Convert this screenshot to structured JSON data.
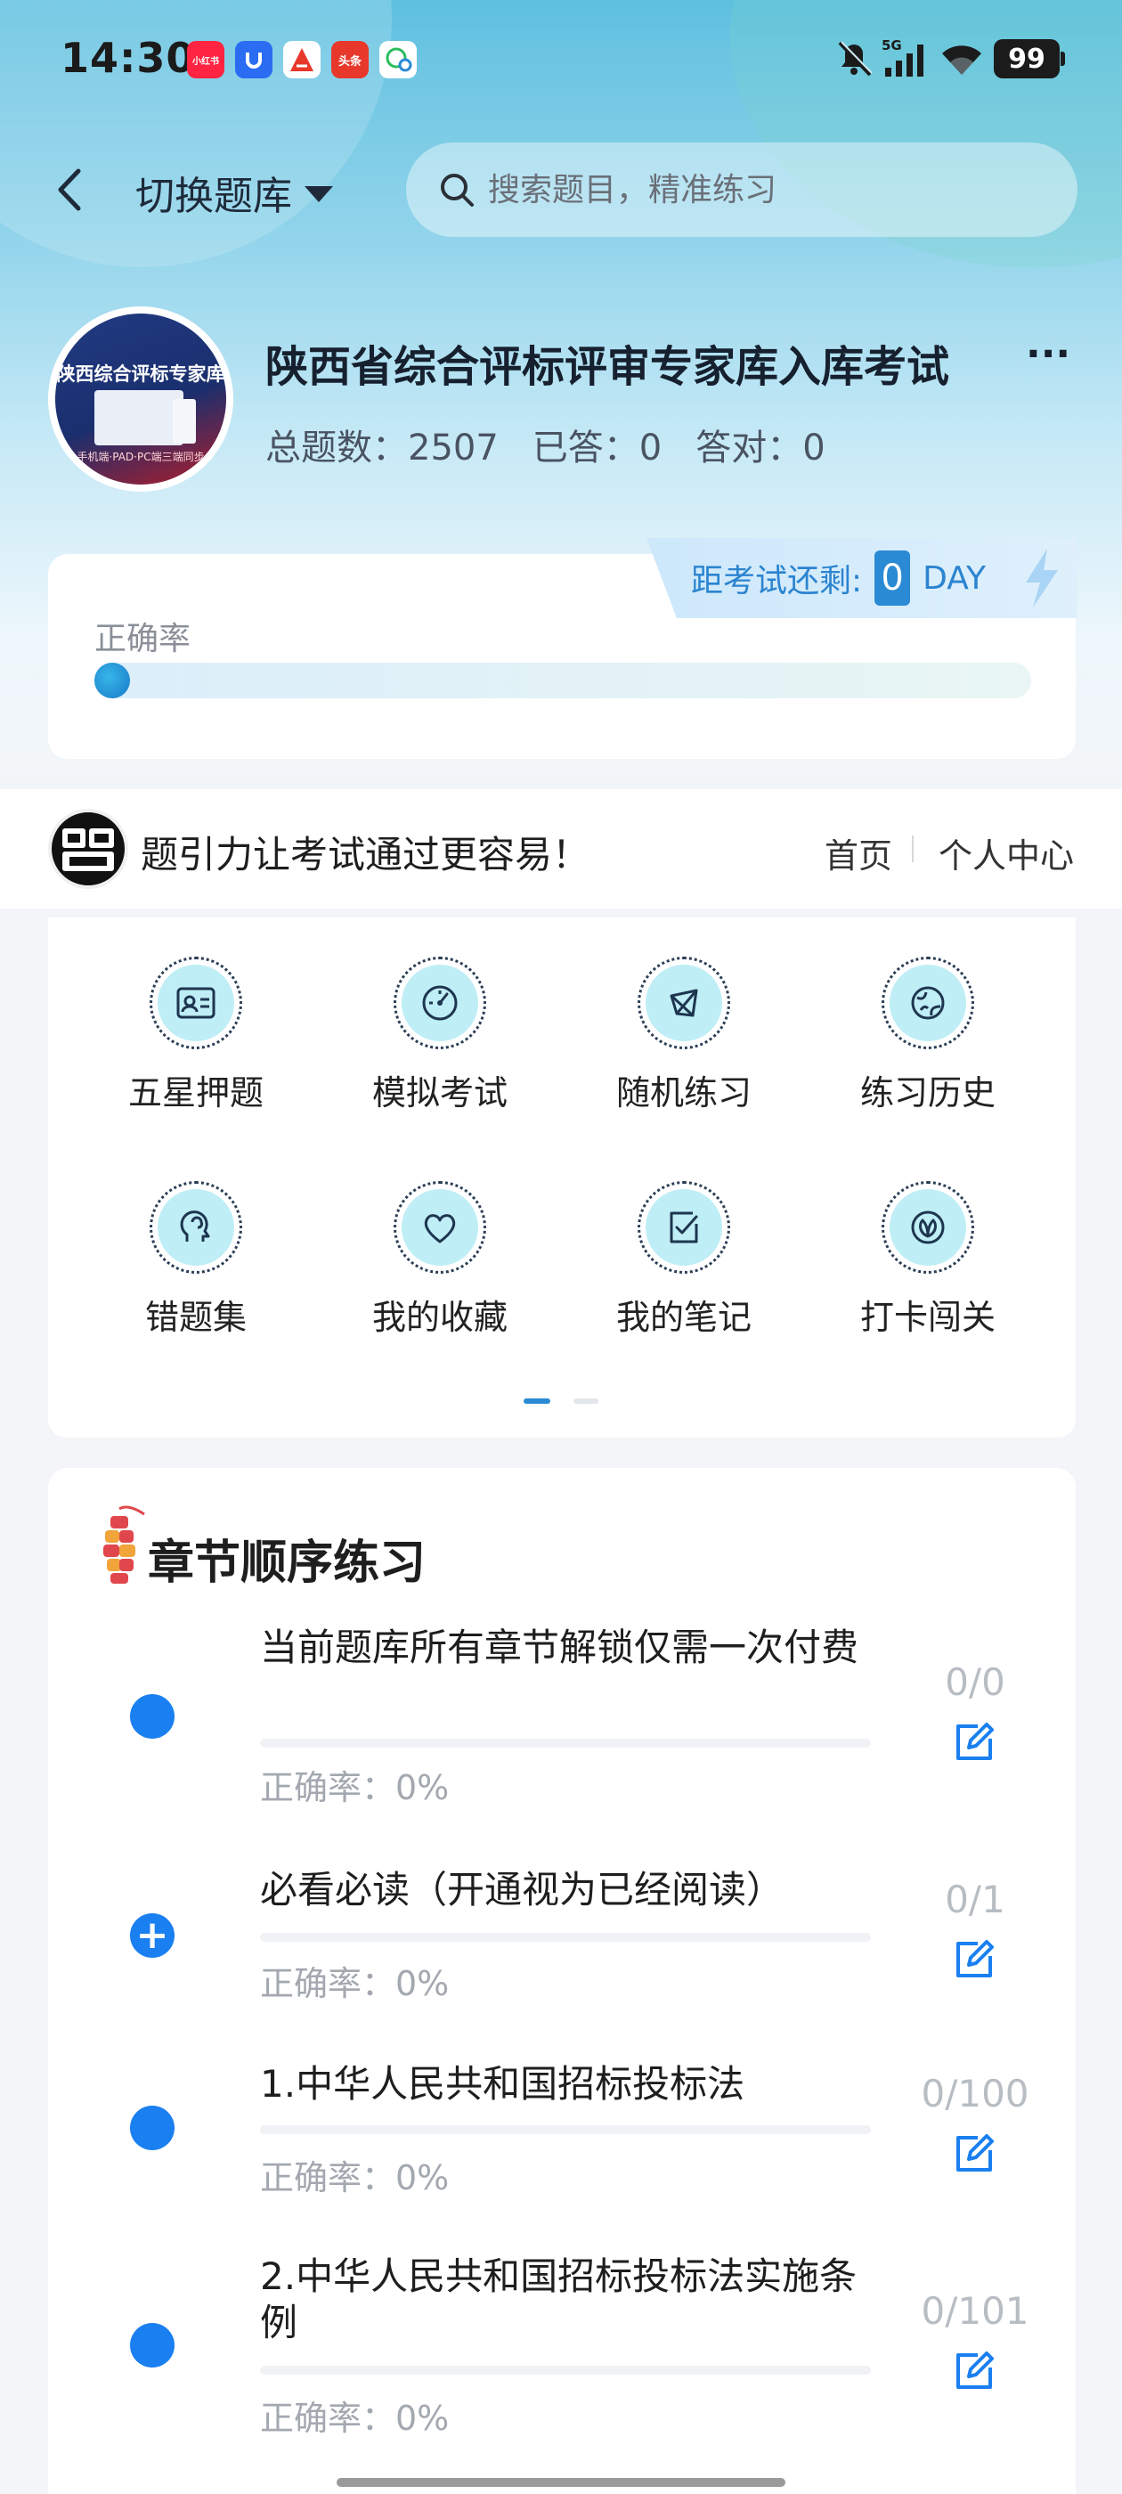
{
  "status_bar": {
    "time": "14:30",
    "apps": [
      {
        "name": "xiaohongshu-icon",
        "label": "小红书",
        "color": "#ff2442"
      },
      {
        "name": "app-blue-icon",
        "label": "",
        "color": "#2a6cf2"
      },
      {
        "name": "app-red-a-icon",
        "label": "",
        "color": "#e8372b"
      },
      {
        "name": "toutiao-icon",
        "label": "头条",
        "color": "#e8372b"
      },
      {
        "name": "wechat-msg-icon",
        "label": "",
        "color": "#ffffff"
      }
    ],
    "network": "5G",
    "battery": "99"
  },
  "nav": {
    "switch_label": "切换题库",
    "search_placeholder": "搜索题目，精准练习"
  },
  "bank": {
    "title": "陕西省综合评标评审专家库入库考试",
    "more": "···",
    "avatar_line1": "陕西综合评标专家库",
    "avatar_line2": "手机端·PAD·PC端三端同步",
    "stats": {
      "total_label": "总题数：",
      "total": "2507",
      "answered_label": "已答：",
      "answered": "0",
      "correct_label": "答对：",
      "correct": "0"
    }
  },
  "accuracy": {
    "label": "正确率",
    "countdown_label": "距考试还剩:",
    "countdown_value": "0",
    "countdown_unit": "DAY",
    "progress": 0
  },
  "promo": {
    "logo": "题引力",
    "text": "题引力让考试通过更容易！",
    "home": "首页",
    "me": "个人中心"
  },
  "functions": [
    {
      "name": "five-star",
      "label": "五星押题"
    },
    {
      "name": "mock-exam",
      "label": "模拟考试"
    },
    {
      "name": "random-practice",
      "label": "随机练习"
    },
    {
      "name": "practice-history",
      "label": "练习历史"
    },
    {
      "name": "wrong-set",
      "label": "错题集"
    },
    {
      "name": "favorites",
      "label": "我的收藏"
    },
    {
      "name": "notes",
      "label": "我的笔记"
    },
    {
      "name": "checkin",
      "label": "打卡闯关"
    }
  ],
  "chapters": {
    "title": "章节顺序练习",
    "items": [
      {
        "title": "当前题库所有章节解锁仅需一次付费",
        "accuracy": "正确率：0%",
        "count": "0/0"
      },
      {
        "title": "必看必读（开通视为已经阅读）",
        "accuracy": "正确率：0%",
        "count": "0/1"
      },
      {
        "title": "1.中华人民共和国招标投标法",
        "accuracy": "正确率：0%",
        "count": "0/100"
      },
      {
        "title": "2.中华人民共和国招标投标法实施条例",
        "accuracy": "正确率：0%",
        "count": "0/101"
      }
    ]
  },
  "colors": {
    "accent": "#1a7ff0",
    "countdown": "#2a8ad4"
  }
}
